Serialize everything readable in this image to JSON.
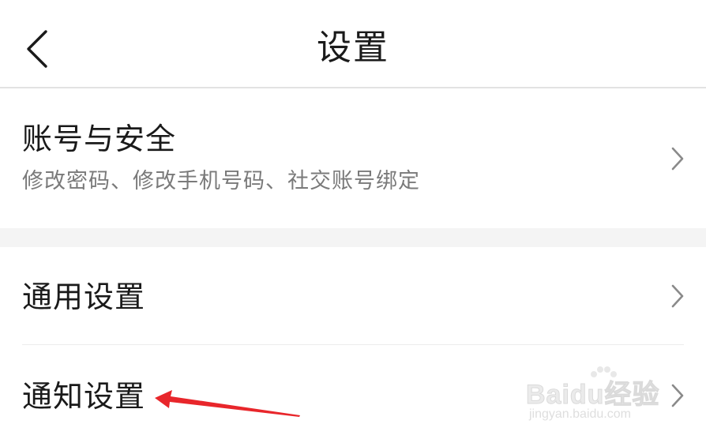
{
  "header": {
    "title": "设置",
    "back_icon": "chevron-left-icon"
  },
  "items": [
    {
      "title": "账号与安全",
      "subtitle": "修改密码、修改手机号码、社交账号绑定",
      "icon": "chevron-right-icon"
    },
    {
      "title": "通用设置",
      "icon": "chevron-right-icon"
    },
    {
      "title": "通知设置",
      "icon": "chevron-right-icon"
    }
  ],
  "annotation": {
    "color": "#e8262b"
  },
  "watermark": {
    "brand": "Baidu经验",
    "url": "jingyan.baidu.com"
  },
  "colors": {
    "text_primary": "#1a1a1a",
    "text_secondary": "#7a7a7a",
    "section_gap": "#f4f4f4",
    "chevron": "#8a8a8a"
  }
}
